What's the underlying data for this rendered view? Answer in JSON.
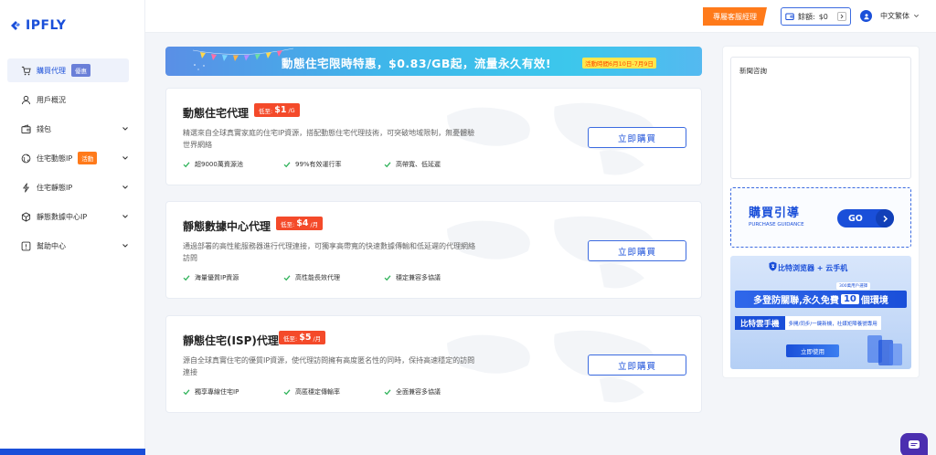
{
  "app": {
    "logo_text": "IPFLY"
  },
  "sidebar": {
    "items": [
      {
        "label": "購買代理",
        "badge": "優惠",
        "badge_color": "#6a7fd8",
        "icon": "cart-icon",
        "active": true,
        "chevron": false
      },
      {
        "label": "用戶概況",
        "icon": "user-icon",
        "chevron": false
      },
      {
        "label": "錢包",
        "icon": "wallet-icon",
        "chevron": true
      },
      {
        "label": "住宅動態IP",
        "badge": "活動",
        "badge_color": "#ff7a1a",
        "icon": "globe-icon",
        "chevron": true
      },
      {
        "label": "住宅靜態IP",
        "icon": "lightning-icon",
        "chevron": true
      },
      {
        "label": "靜態數據中心IP",
        "icon": "cube-icon",
        "chevron": true
      },
      {
        "label": "幫助中心",
        "icon": "help-icon",
        "chevron": true
      }
    ]
  },
  "header": {
    "support_label": "專屬客服經理",
    "balance_label": "餘額:",
    "balance_value": "$0",
    "language": "中文繁体"
  },
  "banner": {
    "text": "動態住宅限時特惠，$0.83/GB起，流量永久有效!",
    "tag": "活動時間6月10日-7月9日"
  },
  "products": [
    {
      "title": "動態住宅代理",
      "price_prefix": "低至:",
      "price": "$1",
      "price_unit": "/G",
      "desc": "精選來自全球真實家庭的住宅IP資源，搭配動態住宅代理技術，可突破地域限制，無憂體驗世界網絡",
      "features": [
        "超9000萬資源池",
        "99%有效運行率",
        "高帶寬、低延遲"
      ],
      "button": "立即購買"
    },
    {
      "title": "靜態數據中心代理",
      "price_prefix": "低至:",
      "price": "$4",
      "price_unit": "/月",
      "desc": "通過部署的高性能服務器進行代理連接，可獨享高帶寬的快速數據傳輸和低延遲的代理網絡訪問",
      "features": [
        "海量優質IP資源",
        "高性能長效代理",
        "穩定兼容多協議"
      ],
      "button": "立即購買"
    },
    {
      "title": "靜態住宅(ISP)代理",
      "price_prefix": "低至:",
      "price": "$5",
      "price_unit": "/月",
      "desc": "源自全球真實住宅的優質IP資源，使代理訪問擁有高度匿名性的同時，保持高速穩定的訪問連接",
      "features": [
        "獨享專線住宅IP",
        "高匿穩定傳輸率",
        "全面兼容多協議"
      ],
      "button": "立即購買"
    }
  ],
  "right_panel": {
    "news_title": "新聞咨詢",
    "guide_title": "購買引導",
    "guide_subtitle": "PURCHASE GUIDANCE",
    "go_label": "GO",
    "promo": {
      "brand": "比特浏览器 + 云手机",
      "users": "300萬用戶選擇",
      "main_before": "多登防關聯,永久免費",
      "main_highlight": "10",
      "main_after": "個環境",
      "strip_left": "比特雲手機",
      "strip_right": "多開/同步/一鍵新機，社媒矩陣養號專用",
      "button": "立即使用"
    }
  },
  "colors": {
    "brand": "#1a4fd9",
    "accent_orange": "#ff7a1a",
    "price_red": "#f44a2a",
    "check_green": "#2fb35a"
  }
}
